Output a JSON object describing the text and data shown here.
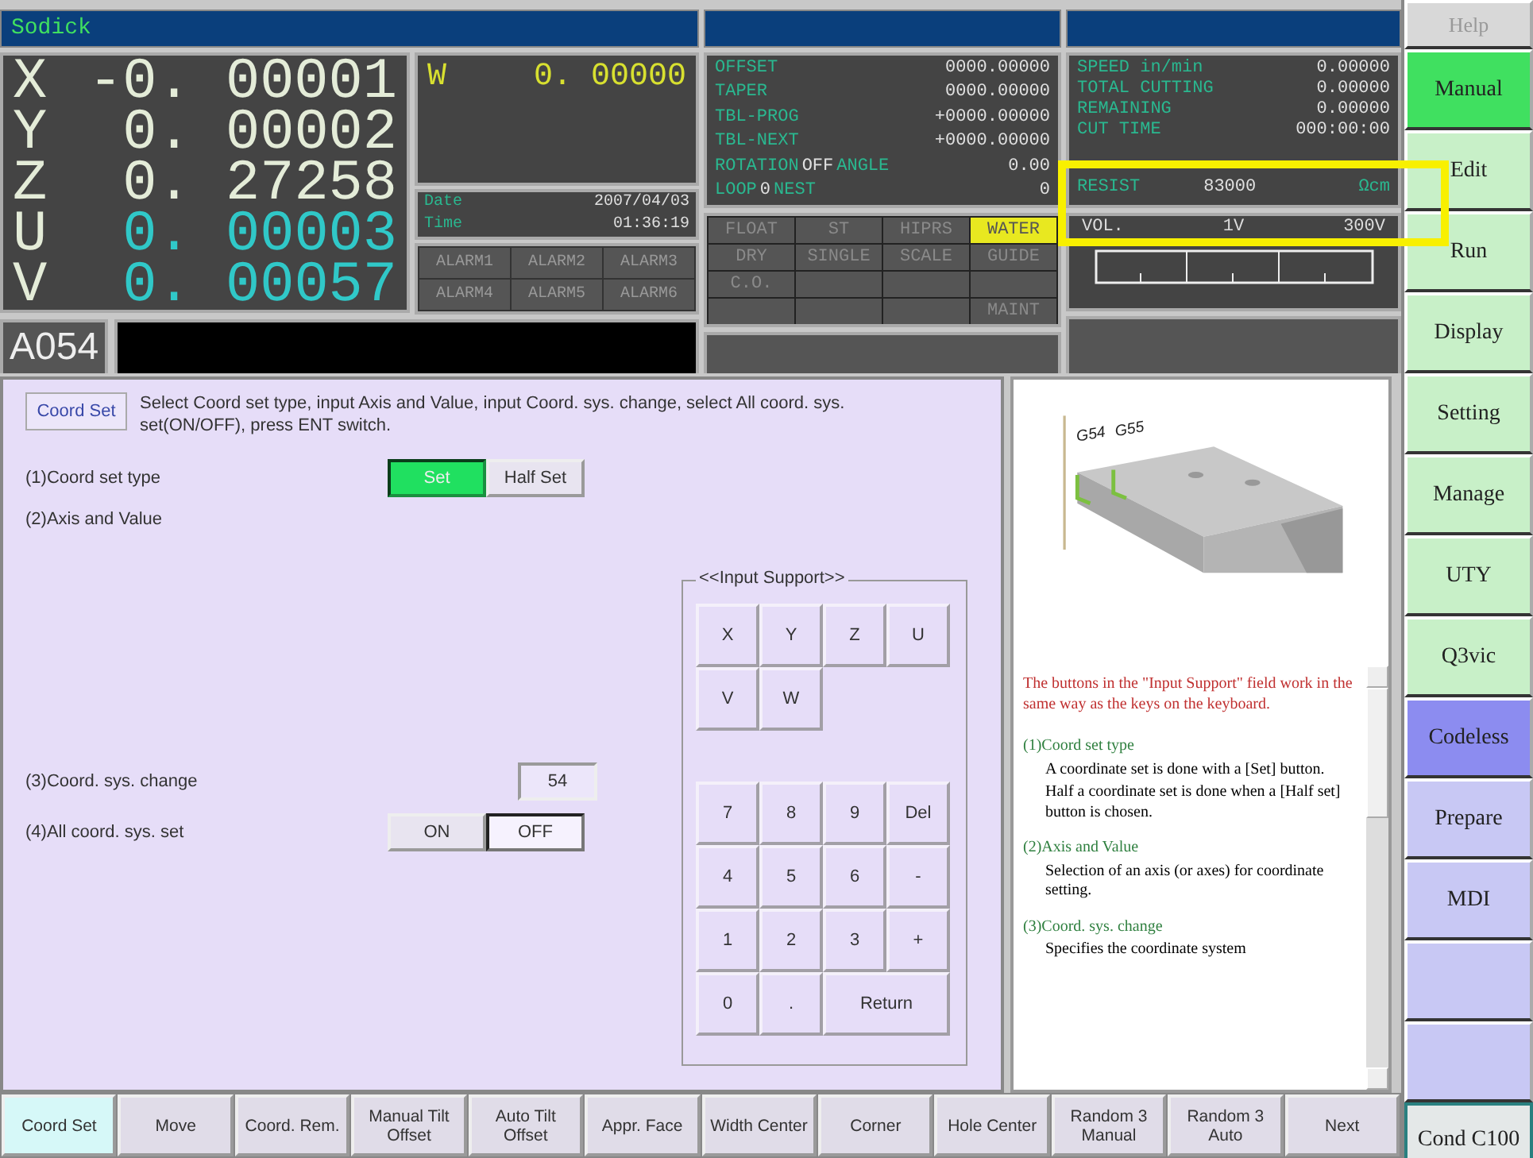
{
  "title_bar": {
    "title": "Sodick"
  },
  "axes": [
    {
      "name": "X",
      "value": "-0. 00001",
      "color": "#e4ecd8"
    },
    {
      "name": "Y",
      "value": "0. 00002",
      "color": "#e4ecd8"
    },
    {
      "name": "Z",
      "value": "0. 27258",
      "color": "#e4ecd8"
    },
    {
      "name": "U",
      "value": "0. 00003",
      "color": "#30c8c8"
    },
    {
      "name": "V",
      "value": "0. 00057",
      "color": "#30c8c8"
    }
  ],
  "w_axis": {
    "name": "W",
    "value": "0. 00000"
  },
  "clock": [
    {
      "label": "Date",
      "value": "2007/04/03"
    },
    {
      "label": "Time",
      "value": "01:36:19"
    }
  ],
  "alarms": [
    "ALARM1",
    "ALARM2",
    "ALARM3",
    "ALARM4",
    "ALARM5",
    "ALARM6"
  ],
  "program": "A054",
  "offsets": [
    {
      "label": "OFFSET",
      "value": "0000.00000"
    },
    {
      "label": "TAPER",
      "value": "0000.00000"
    },
    {
      "label": "TBL-PROG",
      "value": "+0000.00000"
    },
    {
      "label": "TBL-NEXT",
      "value": "+0000.00000"
    },
    {
      "label": "ROTATION",
      "value": "OFF",
      "label2": "ANGLE",
      "value2": "0.00"
    },
    {
      "label": "LOOP",
      "value": "0",
      "label2": "NEST",
      "value2": "0"
    }
  ],
  "modes": [
    {
      "label": "FLOAT",
      "on": false
    },
    {
      "label": "ST",
      "on": false
    },
    {
      "label": "HIPRS",
      "on": false
    },
    {
      "label": "WATER",
      "on": true
    },
    {
      "label": "DRY",
      "on": false
    },
    {
      "label": "SINGLE",
      "on": false
    },
    {
      "label": "SCALE",
      "on": false
    },
    {
      "label": "GUIDE",
      "on": false
    },
    {
      "label": "C.O.",
      "on": false
    },
    {
      "on": false
    },
    {
      "on": false
    },
    {
      "on": false
    },
    {
      "on": false
    },
    {
      "on": false
    },
    {
      "on": false
    },
    {
      "label": "MAINT",
      "on": false
    }
  ],
  "machining": [
    {
      "label": "SPEED in/min",
      "value": "0.00000"
    },
    {
      "label": "TOTAL CUTTING",
      "value": "0.00000"
    },
    {
      "label": "REMAINING",
      "value": "0.00000"
    },
    {
      "label": "CUT TIME",
      "value": "000:00:00"
    }
  ],
  "resist": {
    "label": "RESIST",
    "value": "83000",
    "unit": "Ωcm"
  },
  "voltage": {
    "label": "VOL.",
    "mid": "1V",
    "max": "300V"
  },
  "sidebar": [
    {
      "label": "Help",
      "kind": "header"
    },
    {
      "label": "Manual",
      "kind": "mode",
      "selected": true
    },
    {
      "label": "Edit",
      "kind": "mode",
      "selected": false
    },
    {
      "label": "Run",
      "kind": "mode",
      "selected": false
    },
    {
      "label": "Display",
      "kind": "mode",
      "selected": false
    },
    {
      "label": "Setting",
      "kind": "mode",
      "selected": false
    },
    {
      "label": "Manage",
      "kind": "mode",
      "selected": false
    },
    {
      "label": "UTY",
      "kind": "mode",
      "selected": false
    },
    {
      "label": "Q3vic",
      "kind": "mode",
      "selected": false
    },
    {
      "label": "Codeless",
      "kind": "program",
      "selected": true
    },
    {
      "label": "Prepare",
      "kind": "program",
      "selected": false
    },
    {
      "label": "MDI",
      "kind": "program",
      "selected": false
    },
    {
      "kind": "program",
      "selected": false
    },
    {
      "kind": "program",
      "selected": false
    },
    {
      "label": "Cond C100",
      "kind": "cond"
    }
  ],
  "panel": {
    "title": "Coord Set",
    "instruction": "Select Coord set type, input Axis and Value, input Coord. sys. change, select All coord. sys. set(ON/OFF), press ENT switch.",
    "rows": [
      {
        "kind": "toggle",
        "label": "(1)Coord set type",
        "options": [
          {
            "label": "Set",
            "selected": true
          },
          {
            "label": "Half Set",
            "selected": false
          }
        ]
      },
      {
        "kind": "plain",
        "label": "(2)Axis and Value"
      },
      {
        "kind": "value",
        "label": "(3)Coord. sys. change",
        "value": "54"
      },
      {
        "kind": "toggle",
        "label": "(4)All coord. sys. set",
        "options": [
          {
            "label": "ON",
            "selected": false
          },
          {
            "label": "OFF",
            "selected": true
          }
        ]
      }
    ]
  },
  "input_support": {
    "title": "<<Input Support>>",
    "axis_keys": [
      "X",
      "Y",
      "Z",
      "U",
      "V",
      "W"
    ],
    "num_keys": [
      "7",
      "8",
      "9",
      "Del",
      "4",
      "5",
      "6",
      "-",
      "1",
      "2",
      "3",
      "+",
      "0",
      ".",
      "Return"
    ]
  },
  "help": {
    "labels": [
      "G54",
      "G55"
    ],
    "paragraphs": [
      {
        "kind": "note",
        "text": "The buttons in the \"Input Support\" field work in the same way as the keys on the keyboard."
      },
      {
        "kind": "heading",
        "text": "(1)Coord set type"
      },
      {
        "kind": "body",
        "text": "A coordinate set is done with a [Set] button."
      },
      {
        "kind": "body",
        "text": "Half a coordinate set is done when a [Half set] button is chosen."
      },
      {
        "kind": "heading",
        "text": "(2)Axis and Value"
      },
      {
        "kind": "body",
        "text": "Selection of an axis (or axes) for coordinate setting."
      },
      {
        "kind": "heading",
        "text": "(3)Coord. sys. change"
      },
      {
        "kind": "body",
        "text": "Specifies the coordinate system"
      }
    ]
  },
  "bottom_buttons": [
    {
      "label": "Coord Set",
      "selected": true
    },
    {
      "label": "Move",
      "selected": false
    },
    {
      "label": "Coord. Rem.",
      "selected": false
    },
    {
      "label": "Manual Tilt Offset",
      "selected": false
    },
    {
      "label": "Auto Tilt Offset",
      "selected": false
    },
    {
      "label": "Appr. Face",
      "selected": false
    },
    {
      "label": "Width Center",
      "selected": false
    },
    {
      "label": "Corner",
      "selected": false
    },
    {
      "label": "Hole Center",
      "selected": false
    },
    {
      "label": "Random 3 Manual",
      "selected": false
    },
    {
      "label": "Random 3 Auto",
      "selected": false
    },
    {
      "label": "Next",
      "selected": false
    }
  ]
}
